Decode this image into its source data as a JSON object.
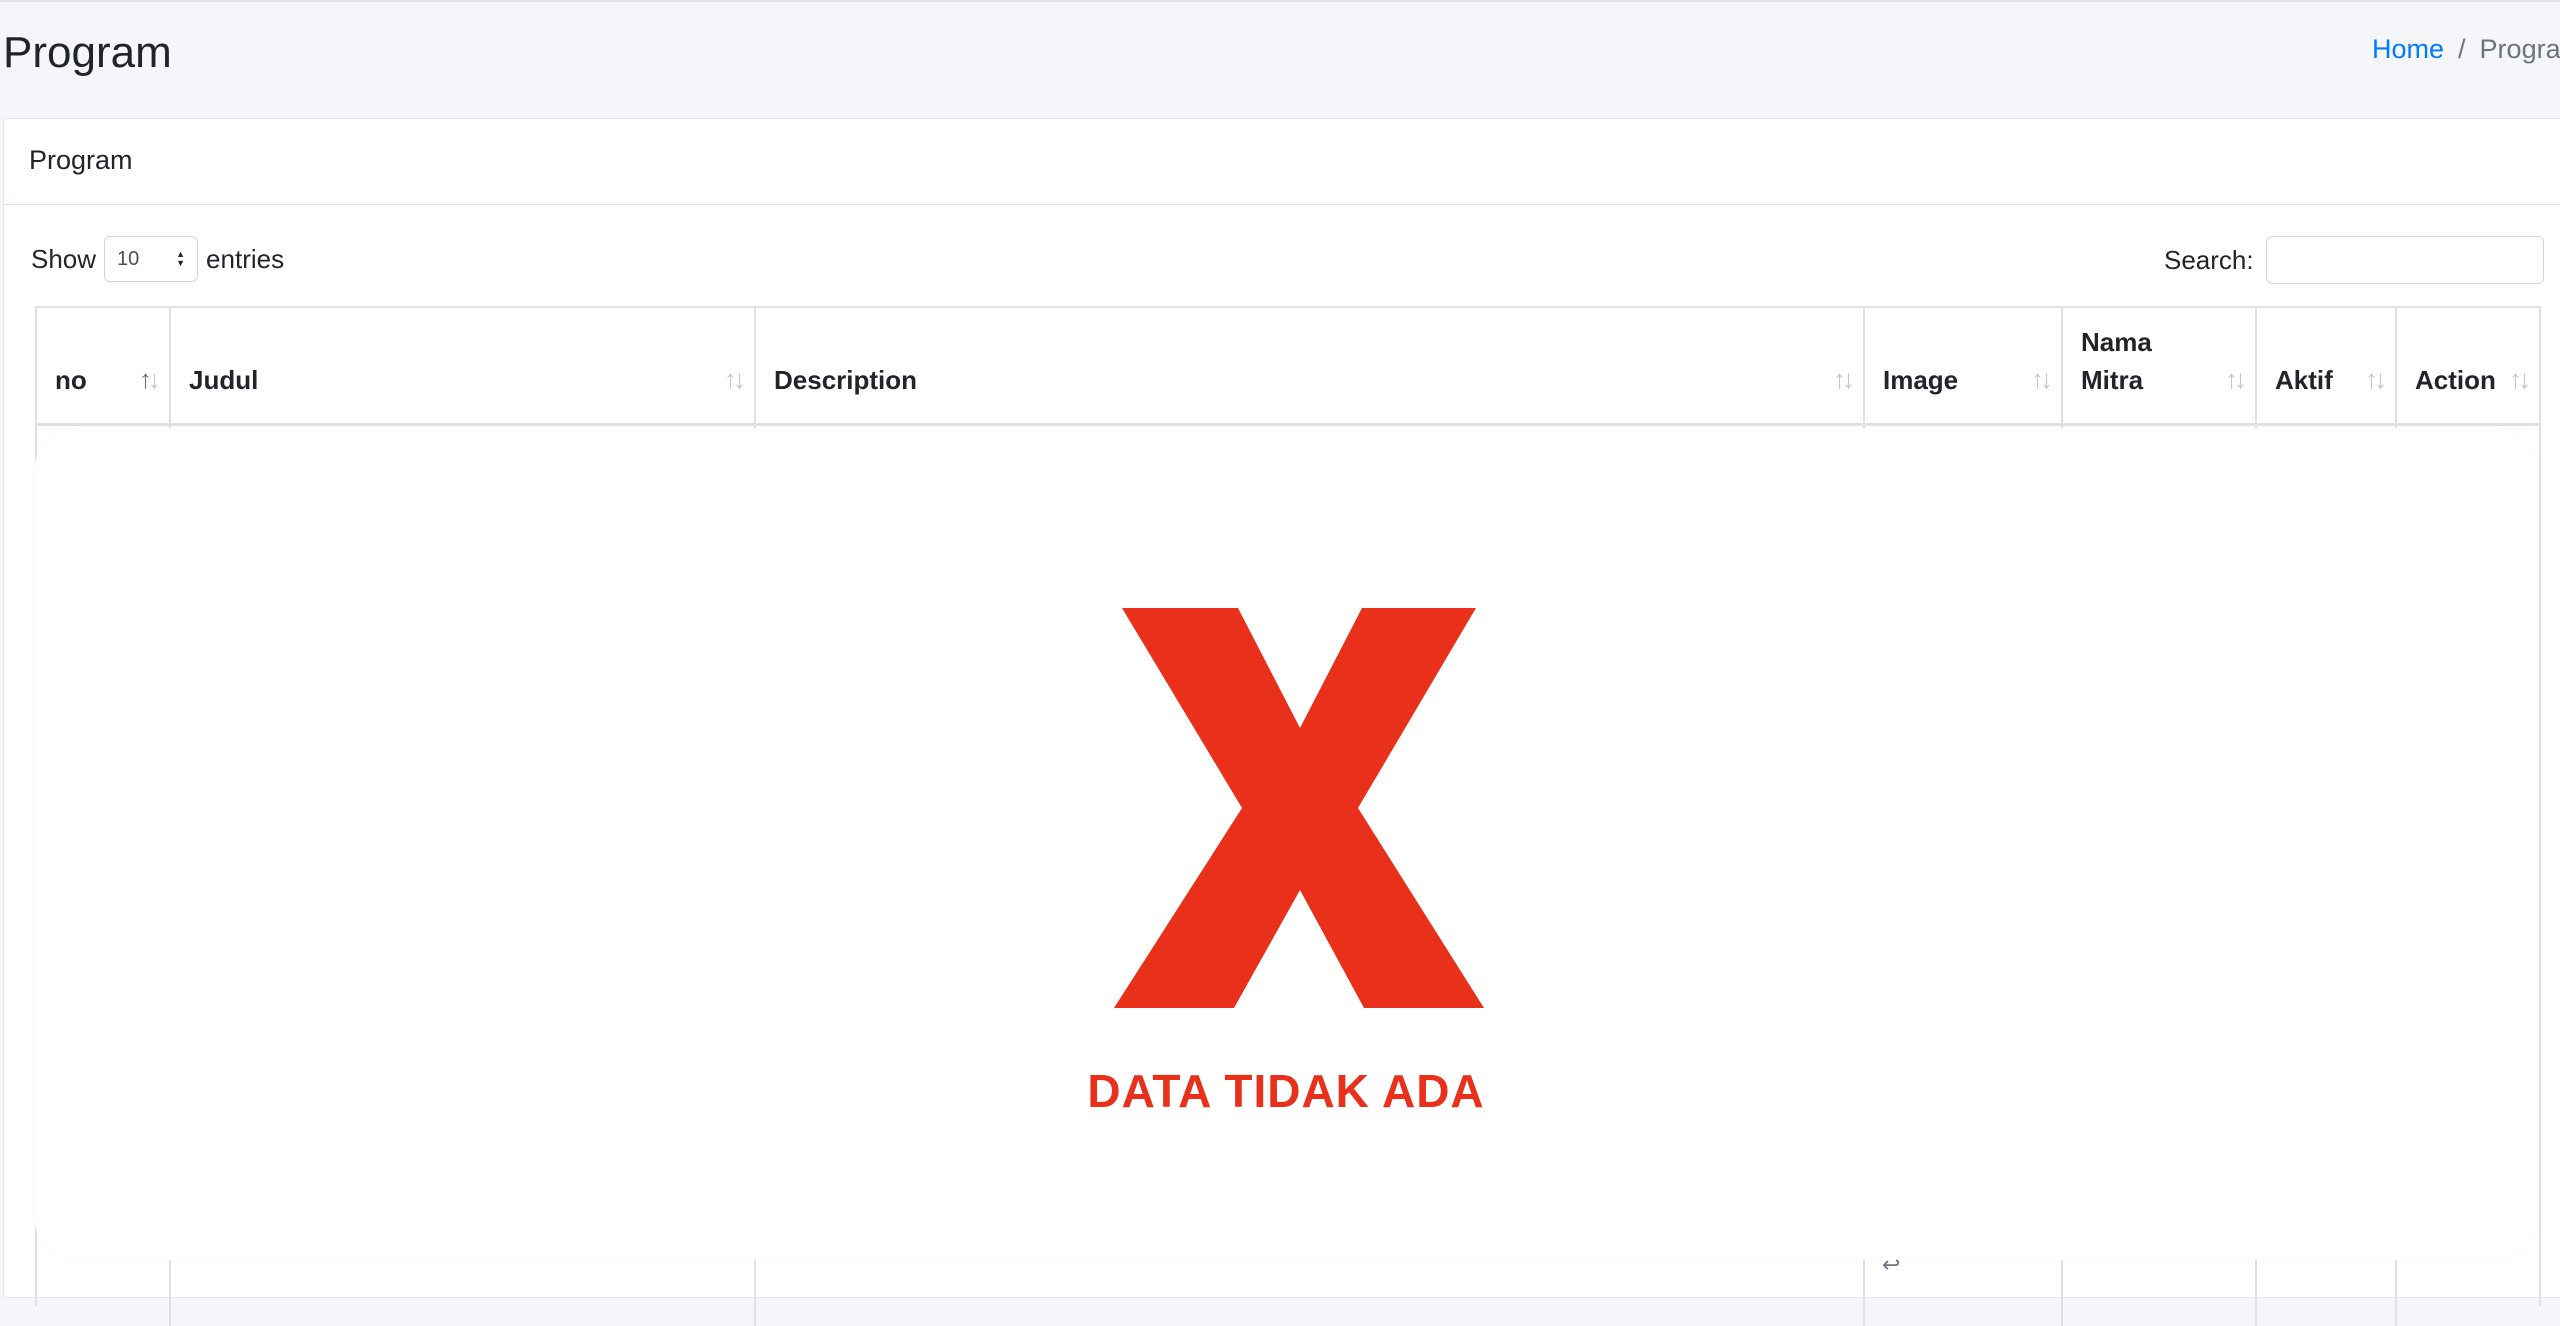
{
  "header": {
    "title": "Program",
    "breadcrumb": {
      "home": "Home",
      "separator": "/",
      "current": "Program"
    }
  },
  "card": {
    "title": "Program"
  },
  "table_controls": {
    "show_label": "Show",
    "entries_value": "10",
    "entries_label": "entries",
    "search_label": "Search:",
    "search_value": ""
  },
  "table": {
    "columns": [
      "no",
      "Judul",
      "Description",
      "Image",
      "Nama Mitra",
      "Aktif",
      "Action"
    ]
  },
  "empty_state": {
    "message": "DATA TIDAK ADA",
    "icon": "x-icon",
    "color": "#e8301a"
  },
  "colors": {
    "link": "#007bff",
    "error": "#e8301a",
    "background": "#f4f6f9"
  }
}
